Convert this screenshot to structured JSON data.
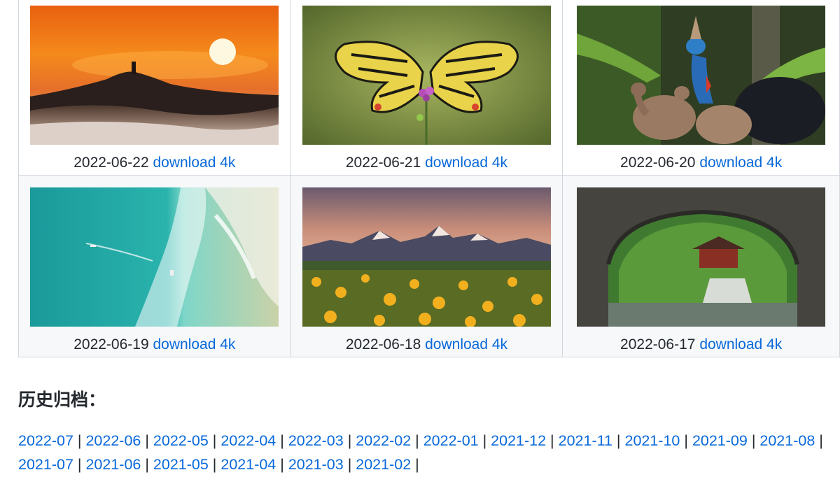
{
  "gallery": {
    "rows": [
      [
        {
          "date": "2022-06-22",
          "link": "download 4k",
          "image": "sunset-hill-fog"
        },
        {
          "date": "2022-06-21",
          "link": "download 4k",
          "image": "swallowtail-butterflies"
        },
        {
          "date": "2022-06-20",
          "link": "download 4k",
          "image": "cassowary-family"
        }
      ],
      [
        {
          "date": "2022-06-19",
          "link": "download 4k",
          "image": "aerial-surf-beach"
        },
        {
          "date": "2022-06-18",
          "link": "download 4k",
          "image": "wildflowers-mountains"
        },
        {
          "date": "2022-06-17",
          "link": "download 4k",
          "image": "stone-arch-bridge-temple"
        }
      ]
    ]
  },
  "archive": {
    "title": "历史归档：",
    "months": [
      "2022-07",
      "2022-06",
      "2022-05",
      "2022-04",
      "2022-03",
      "2022-02",
      "2022-01",
      "2021-12",
      "2021-11",
      "2021-10",
      "2021-09",
      "2021-08",
      "2021-07",
      "2021-06",
      "2021-05",
      "2021-04",
      "2021-03",
      "2021-02"
    ],
    "separator": "|"
  },
  "colors": {
    "link": "#0969da",
    "text": "#24292f",
    "border": "#d0d7de",
    "alt_row": "#f6f8fa"
  }
}
